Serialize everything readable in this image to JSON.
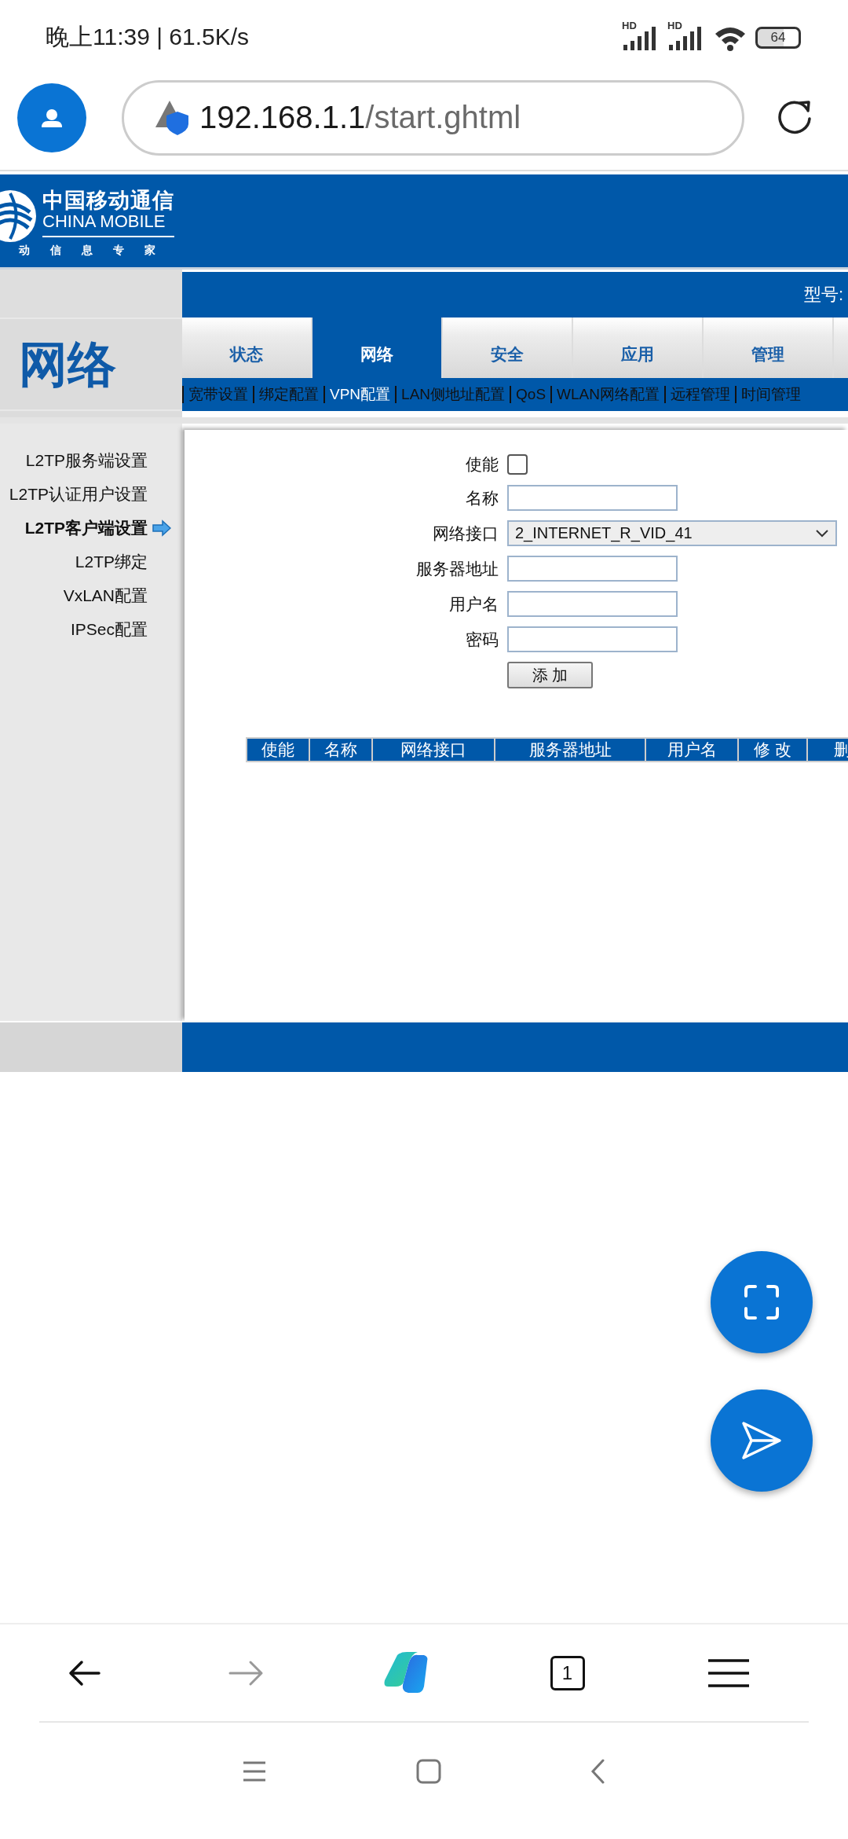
{
  "status_bar": {
    "time_speed": "晚上11:39 | 61.5K/s",
    "signal_labels": [
      "HD",
      "HD"
    ],
    "battery": "64"
  },
  "browser": {
    "url_host": "192.168.1.1",
    "url_path": "/start.ghtml"
  },
  "router": {
    "logo": {
      "name_cn": "中国移动通信",
      "name_en": "CHINA MOBILE",
      "slogan": "动 信 息 专 家"
    },
    "section_title": "网络",
    "model_label": "型号:",
    "tabs": [
      {
        "label": "状态",
        "selected": false
      },
      {
        "label": "网络",
        "selected": true
      },
      {
        "label": "安全",
        "selected": false
      },
      {
        "label": "应用",
        "selected": false
      },
      {
        "label": "管理",
        "selected": false
      }
    ],
    "subnav": [
      {
        "label": "宽带设置",
        "selected": false
      },
      {
        "label": "绑定配置",
        "selected": false
      },
      {
        "label": "VPN配置",
        "selected": true
      },
      {
        "label": "LAN侧地址配置",
        "selected": false
      },
      {
        "label": "QoS",
        "selected": false
      },
      {
        "label": "WLAN网络配置",
        "selected": false
      },
      {
        "label": "远程管理",
        "selected": false
      },
      {
        "label": "时间管理",
        "selected": false
      }
    ],
    "sidebar": [
      {
        "label": "L2TP服务端设置",
        "selected": false
      },
      {
        "label": "L2TP认证用户设置",
        "selected": false
      },
      {
        "label": "L2TP客户端设置",
        "selected": true
      },
      {
        "label": "L2TP绑定",
        "selected": false
      },
      {
        "label": "VxLAN配置",
        "selected": false
      },
      {
        "label": "IPSec配置",
        "selected": false
      }
    ],
    "form": {
      "fields": [
        {
          "kind": "checkbox",
          "label": "使能",
          "checked": false
        },
        {
          "kind": "text",
          "label": "名称"
        },
        {
          "kind": "select",
          "label": "网络接口",
          "value": "2_INTERNET_R_VID_41"
        },
        {
          "kind": "text",
          "label": "服务器地址"
        },
        {
          "kind": "text",
          "label": "用户名"
        },
        {
          "kind": "password",
          "label": "密码"
        }
      ],
      "button": "添 加"
    },
    "table": {
      "columns": [
        "使能",
        "名称",
        "网络接口",
        "服务器地址",
        "用户名",
        "修 改",
        "删"
      ]
    }
  },
  "bottom_nav": {
    "tab_count": "1"
  }
}
